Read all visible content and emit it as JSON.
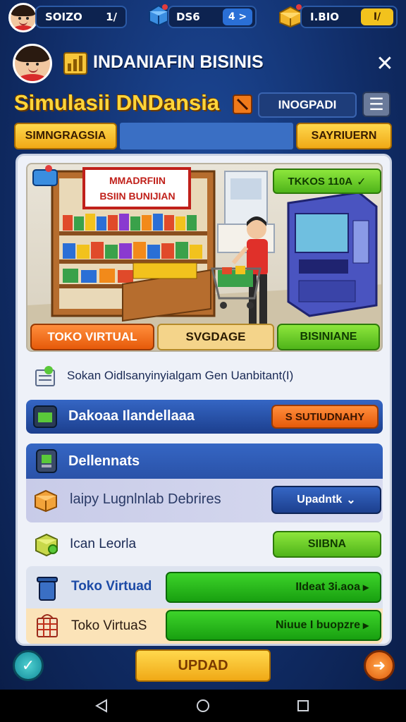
{
  "top_bar": {
    "player_value": "SOIZO",
    "player_btn": "1/",
    "gems_value": "DS6",
    "gems_btn": "4 >",
    "gold_value": "I.BIO",
    "gold_btn": "I/"
  },
  "header": {
    "brand_title": "INDANIAFIN BISINIS",
    "close_glyph": "✕"
  },
  "title_row": {
    "title": "Simulasii DNDansia",
    "field_value": "INOGPADI",
    "menu_glyph": "☰"
  },
  "tabs": {
    "left": "SIMNGRAGSIA",
    "right": "SAYRIUERN"
  },
  "scene": {
    "store_sign": "MMADRFIIN\nBSIIN BUNIJIAN",
    "status_badge": "TKKOS 110A",
    "btn_left": "TOKO VIRTUAL",
    "btn_mid": "SVGDAGE",
    "btn_right": "BISINIANE"
  },
  "list": {
    "subtitle": "Sokan Oidlsanyinyialgam Gen Uanbitant(I)",
    "row1_label": "Dakoaa Ilandellaaa",
    "row1_btn": "S SUTIUDNAHY",
    "row2_label": "Dellennats",
    "row3_label": "laipy Lugnlnlab Debrires",
    "row3_btn": "Upadntk",
    "row4_label": "Ican Leorla",
    "row4_btn": "SIIBNA",
    "row5_label": "Toko Virtuad",
    "row5_btn": "IIdeat 3i.aoa",
    "row6_label": "Toko VirtuaS",
    "row6_btn": "Niuue I buopzre"
  },
  "footer": {
    "main_btn": "UPDAD"
  },
  "colors": {
    "accent_yellow": "#ffd53a",
    "bg_blue": "#102c66",
    "green": "#4fb41a",
    "orange": "#e65a0a"
  }
}
